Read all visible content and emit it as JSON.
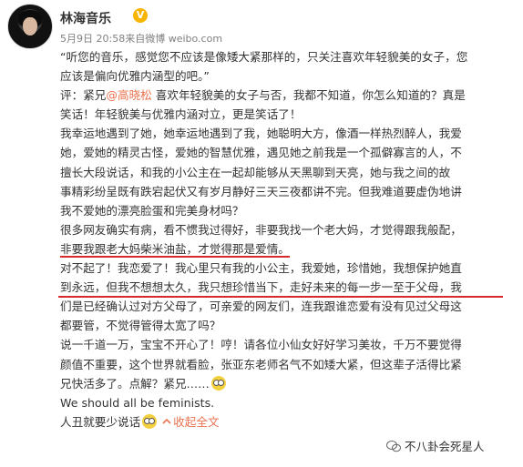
{
  "user": {
    "name": "林海音乐",
    "verified_badge": "V"
  },
  "meta": {
    "date": "5月9日 20:58",
    "source_prefix": "来自",
    "source": "微博 weibo.com"
  },
  "post": {
    "quote_line1": "“听您的音乐，感觉您不应该是像矮大紧那样的，只关注喜欢年轻貌美的女子，您",
    "quote_line2": "应该是偏向优雅内涵型的吧。”",
    "reply_prefix": "评：紧兄",
    "mention": "@高晓松",
    "reply_rest1": " 喜欢年轻貌美的女子与否，我都不知道，你怎么知道的？真是",
    "reply_line2": "笑话！年轻貌美与优雅内涵对立，更是笑话了！",
    "p3_l1": "我幸运地遇到了她，她幸运地遇到了我，她聪明大方，像酒一样热烈醉人，我爱",
    "p3_l2": "她，爱她的精灵古怪，爱她的智慧优雅，遇见她之前我是一个孤僻寡言的人，不",
    "p3_l3": "擅长大段说话，和我的小公主在一起却能够从天黑聊到天亮，她与我之间的故",
    "p3_l4": "事精彩纷呈既有跌宕起伏又有岁月静好三天三夜都讲不完。但我难道要虚伪地讲",
    "p3_l5": "我不爱她的漂亮脸蛋和完美身材吗？",
    "p4_a": "很多网友确实有病，",
    "p4_b": "看不惯我过得好，非要我找一个老大妈，才觉得跟我般配，",
    "p4_l2": "非要我跟老大妈柴米油盐，才觉得那是爱情。",
    "p5_l1": "对不起了！我恋爱了！我心里只有我的小公主，我爱她，珍惜她，我想保护她直",
    "p5_l2": "到永远，但我不想想太久，我只想珍惜当下，走好未来的每一步一至于父母，我",
    "p5_l3": "们是已经确认过对方父母了，可亲爱的网友们，连我跟谁恋爱有没有见过父母这",
    "p5_l4": "都要管，不觉得管得太宽了吗？",
    "p6_l1": "说一千道一万，宝宝不开心了！哼！请各位小仙女好好学习美妆，千万不要觉得",
    "p6_l2": "颜值不重要，这个世界就看脸，张亚东老师名气不如矮大紧，但这辈子活得比紧",
    "p6_l3": "兄快活多了。点解？紧兄……",
    "p7": "We should all be feminists.",
    "p8": "人丑就要少说话",
    "collapse_label": "收起全文"
  },
  "watermark": {
    "text": "不八卦会死星人"
  },
  "colors": {
    "link": "#eb7350",
    "underline": "#d62b2b",
    "badge": "#f7b500"
  },
  "icons": {
    "verified": "verified-badge-icon",
    "emoji": "staring-emoji-icon",
    "collapse": "collapse-arrow-icon",
    "watermark": "wechat-watermark-icon",
    "menu": "chevron-down-icon"
  }
}
